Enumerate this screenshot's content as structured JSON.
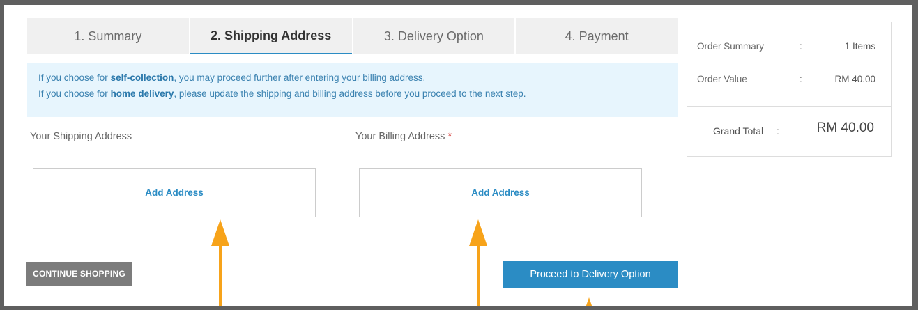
{
  "tabs": [
    {
      "label": "1. Summary",
      "active": false
    },
    {
      "label": "2. Shipping Address",
      "active": true
    },
    {
      "label": "3. Delivery Option",
      "active": false
    },
    {
      "label": "4. Payment",
      "active": false
    }
  ],
  "info": {
    "line1_pre": "If you choose for ",
    "line1_bold": "self-collection",
    "line1_post": ", you may proceed further after entering your billing address.",
    "line2_pre": "If you choose for ",
    "line2_bold": "home delivery",
    "line2_post": ", please update the shipping and billing address before you proceed to the next step."
  },
  "shipping": {
    "label": "Your Shipping Address",
    "add_label": "Add Address"
  },
  "billing": {
    "label": "Your Billing Address",
    "required_marker": "*",
    "add_label": "Add Address"
  },
  "buttons": {
    "continue_shopping": "CONTINUE SHOPPING",
    "proceed": "Proceed to Delivery Option"
  },
  "summary": {
    "order_summary_label": "Order Summary",
    "order_summary_sep": ":",
    "order_summary_value": "1 Items",
    "order_value_label": "Order Value",
    "order_value_sep": ":",
    "order_value_value": "RM 40.00",
    "grand_total_label": "Grand Total",
    "grand_total_sep": ":",
    "grand_total_value": "RM 40.00"
  },
  "colors": {
    "accent": "#2b8cc4",
    "annotation_arrow": "#f7a31a",
    "info_bg": "#e7f5fd",
    "continue_button": "#7c7c7c"
  }
}
